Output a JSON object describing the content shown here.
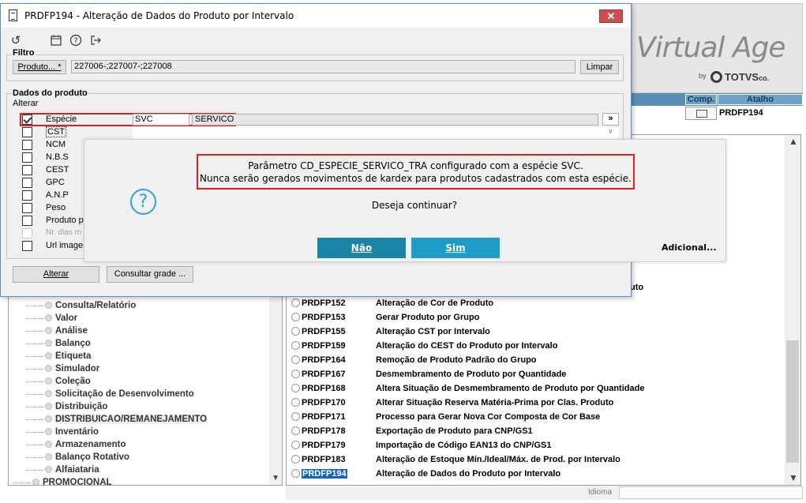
{
  "window": {
    "title": "PRDFP194 - Alteração de Dados do Produto por Intervalo",
    "close_label": "✕"
  },
  "toolbar": {
    "icons": [
      "refresh-icon",
      "calendar-icon",
      "help-icon",
      "exit-icon"
    ]
  },
  "filtro": {
    "label": "Filtro",
    "produto_button": "Produto... *",
    "value": "227006-;227007-;227008",
    "limpar_button": "Limpar"
  },
  "dados": {
    "label": "Dados do produto",
    "alterar_label": "Alterar",
    "especie": {
      "label": "Espécie",
      "code": "SVC",
      "description": "SERVICO",
      "lookup": "»",
      "checked": true
    },
    "properties": [
      "CST",
      "NCM",
      "N.B.S",
      "CEST",
      "GPC",
      "A.N.P",
      "Peso",
      "Produto p",
      "Nr. dias m",
      "Url imager"
    ],
    "alterar_button": "Alterar",
    "consultar_grade_button": "Consultar grade ..."
  },
  "dialog": {
    "message_line1": "Parâmetro CD_ESPECIE_SERVICO_TRA configurado com a espécie SVC.",
    "message_line2": "Nunca serão gerados movimentos de kardex para produtos cadastrados com esta espécie.",
    "question": "Deseja continuar?",
    "nao_button": "Não",
    "sim_button": "Sim",
    "adicional_button": "Adicional..."
  },
  "background": {
    "logo": {
      "text": "Virtual Age",
      "by": "by",
      "brand": "TOTVS",
      "suffix": "co."
    },
    "header": {
      "comp": "Comp.",
      "atalho": "Atalho",
      "row_code": "PRDFP194"
    },
    "partial_text": "uto",
    "tree_items": [
      "Consulta/Relatório",
      "Valor",
      "Análise",
      "Balanço",
      "Etiqueta",
      "Simulador",
      "Coleção",
      "Solicitação de Desenvolvimento",
      "Distribuição",
      "DISTRIBUICAO/REMANEJAMENTO",
      "Inventário",
      "Armazenamento",
      "Balanço Rotativo",
      "Alfaiataria",
      "PROMOCIONAL"
    ],
    "list_rows": [
      {
        "code": "PRDFP152",
        "desc": "Alteração de Cor de Produto"
      },
      {
        "code": "PRDFP153",
        "desc": "Gerar Produto por Grupo"
      },
      {
        "code": "PRDFP155",
        "desc": "Alteração CST por Intervalo"
      },
      {
        "code": "PRDFP159",
        "desc": "Alteração do CEST do Produto por Intervalo"
      },
      {
        "code": "PRDFP164",
        "desc": "Remoção de Produto Padrão do Grupo"
      },
      {
        "code": "PRDFP167",
        "desc": "Desmembramento de Produto por Quantidade"
      },
      {
        "code": "PRDFP168",
        "desc": "Altera Situação de Desmembramento de Produto por Quantidade"
      },
      {
        "code": "PRDFP170",
        "desc": "Alterar Situação Reserva Matéria-Prima por Clas. Produto"
      },
      {
        "code": "PRDFP171",
        "desc": "Processo para Gerar Nova Cor Composta de Cor Base"
      },
      {
        "code": "PRDFP178",
        "desc": "Exportação de Produto para CNP/GS1"
      },
      {
        "code": "PRDFP179",
        "desc": "Importação de Código EAN13 do CNP/GS1"
      },
      {
        "code": "PRDFP183",
        "desc": "Alteração de Estoque Mín./Ideal/Máx. de Prod. por Intervalo"
      },
      {
        "code": "PRDFP194",
        "desc": "Alteração de Dados do Produto por Intervalo"
      }
    ],
    "status_label": "Idioma"
  }
}
